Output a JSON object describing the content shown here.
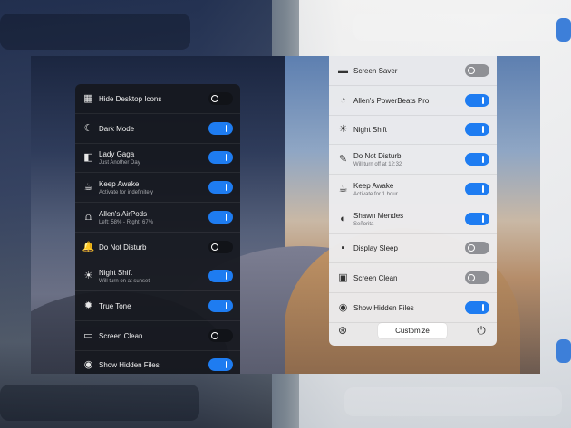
{
  "dark_panel": {
    "items": [
      {
        "icon": "grid-icon",
        "glyph": "▦",
        "title": "Hide Desktop Icons",
        "subtitle": "",
        "on": false
      },
      {
        "icon": "moon-icon",
        "glyph": "☾",
        "title": "Dark Mode",
        "subtitle": "",
        "on": true
      },
      {
        "icon": "music-app-icon",
        "glyph": "◧",
        "title": "Lady Gaga",
        "subtitle": "Just Another Day",
        "on": true
      },
      {
        "icon": "coffee-cup-icon",
        "glyph": "☕",
        "title": "Keep Awake",
        "subtitle": "Activate for indefinitely",
        "on": true
      },
      {
        "icon": "airpods-icon",
        "glyph": "⩍",
        "title": "Allen's AirPods",
        "subtitle": "Left: 58% - Right: 67%",
        "on": true
      },
      {
        "icon": "bell-icon",
        "glyph": "🔔",
        "title": "Do Not Disturb",
        "subtitle": "",
        "on": false
      },
      {
        "icon": "night-shift-icon",
        "glyph": "☀",
        "title": "Night Shift",
        "subtitle": "Will turn on at sunset",
        "on": true
      },
      {
        "icon": "true-tone-icon",
        "glyph": "✹",
        "title": "True Tone",
        "subtitle": "",
        "on": true
      },
      {
        "icon": "screen-clean-icon",
        "glyph": "▭",
        "title": "Screen Clean",
        "subtitle": "",
        "on": false
      },
      {
        "icon": "eye-icon",
        "glyph": "◉",
        "title": "Show Hidden Files",
        "subtitle": "",
        "on": true
      }
    ]
  },
  "light_panel": {
    "items": [
      {
        "icon": "screen-saver-icon",
        "glyph": "▬",
        "title": "Screen Saver",
        "subtitle": "",
        "on": false
      },
      {
        "icon": "headphones-icon",
        "glyph": "◔",
        "title": "Allen's PowerBeats Pro",
        "subtitle": "",
        "on": true
      },
      {
        "icon": "night-shift-icon",
        "glyph": "☀",
        "title": "Night Shift",
        "subtitle": "",
        "on": true
      },
      {
        "icon": "do-not-disturb-icon",
        "glyph": "✎",
        "title": "Do Not Disturb",
        "subtitle": "Will turn off at 12:32",
        "on": true
      },
      {
        "icon": "coffee-cup-icon",
        "glyph": "☕",
        "title": "Keep Awake",
        "subtitle": "Activate for 1 hour",
        "on": true
      },
      {
        "icon": "music-app-icon",
        "glyph": "◐",
        "title": "Shawn Mendes",
        "subtitle": "Señorita",
        "on": true
      },
      {
        "icon": "display-sleep-icon",
        "glyph": "▪",
        "title": "Display Sleep",
        "subtitle": "",
        "on": false
      },
      {
        "icon": "screen-clean-icon",
        "glyph": "▣",
        "title": "Screen Clean",
        "subtitle": "",
        "on": false
      },
      {
        "icon": "eye-icon",
        "glyph": "◉",
        "title": "Show Hidden Files",
        "subtitle": "",
        "on": true
      }
    ],
    "footer": {
      "customize_label": "Customize",
      "left_icon": "settings-wheel-icon",
      "left_glyph": "⊛",
      "right_icon": "power-icon",
      "right_glyph": "⏻"
    }
  },
  "colors": {
    "toggle_on": "#1e7cf1",
    "dark_panel_bg": "#16181e",
    "light_panel_bg": "#ececee"
  }
}
